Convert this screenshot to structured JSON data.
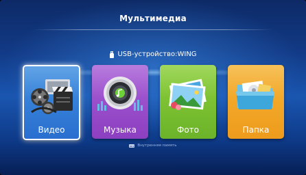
{
  "header": {
    "title": "Мультимедиа"
  },
  "device": {
    "label": "USB-устройство:WING",
    "icon": "usb-drive-icon"
  },
  "tiles": [
    {
      "label": "Видео",
      "icon": "film-reel-clapper-icon",
      "color": "#2f7ad6",
      "selected": true
    },
    {
      "label": "Музыка",
      "icon": "speaker-equalizer-icon",
      "color": "#9a4fcc",
      "selected": false
    },
    {
      "label": "Фото",
      "icon": "photo-stack-icon",
      "color": "#7cc232",
      "selected": false
    },
    {
      "label": "Папка",
      "icon": "folder-icon",
      "color": "#f2a428",
      "selected": false
    }
  ],
  "storage": {
    "label": "Внутренняя память",
    "icon": "hard-drive-icon"
  }
}
